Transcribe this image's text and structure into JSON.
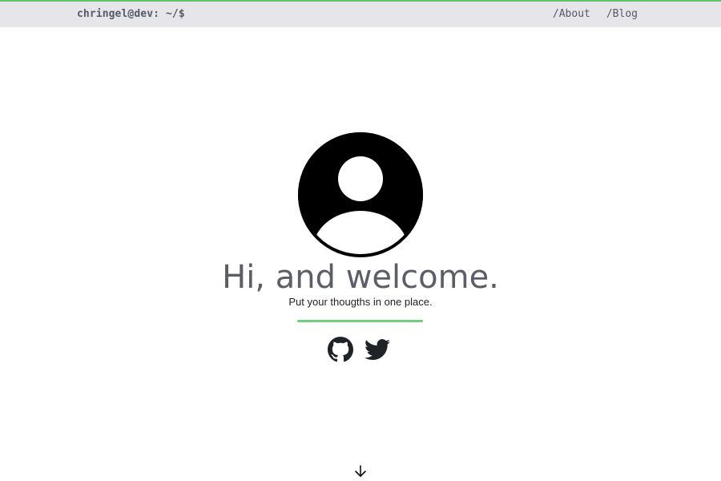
{
  "header": {
    "brand": "chringel@dev: ~/$",
    "nav": [
      {
        "label": "/About"
      },
      {
        "label": "/Blog"
      }
    ]
  },
  "hero": {
    "avatar_icon": "user-avatar-icon",
    "title": "Hi, and welcome.",
    "subtitle": "Put your thougths in one place."
  },
  "social": {
    "icons": [
      "github-icon",
      "twitter-icon"
    ]
  },
  "scroll": {
    "icon": "arrow-down-icon"
  },
  "colors": {
    "accent": "#6fcf7a",
    "topbar_bg": "#e5e5ea",
    "text_muted": "#5b5d68"
  }
}
